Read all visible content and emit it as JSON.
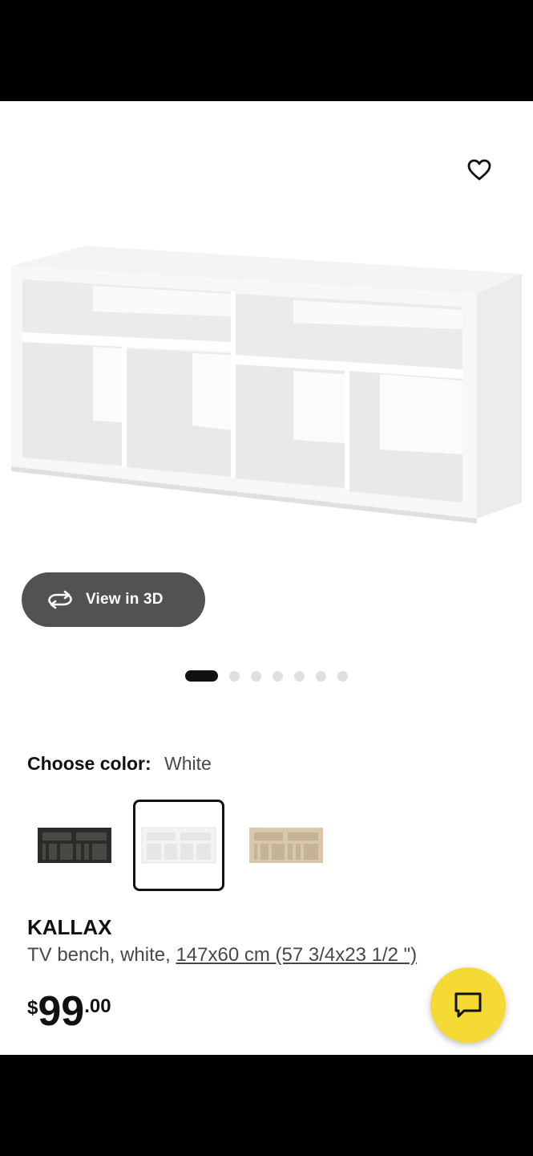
{
  "colors": {
    "accent_chat": "#f5d934",
    "view3d_bg": "#525252",
    "text_primary": "#111111",
    "text_secondary": "#484848"
  },
  "gallery": {
    "favorite_icon": "heart-outline-icon",
    "view3d_label": "View in 3D",
    "view3d_icon": "rotate-3d-icon",
    "total_images": 7,
    "active_index": 0
  },
  "color_choice": {
    "label": "Choose color:",
    "selected": "White",
    "swatches": [
      {
        "name": "black-brown",
        "selected": false
      },
      {
        "name": "white",
        "selected": true
      },
      {
        "name": "white-stained-oak",
        "selected": false
      }
    ]
  },
  "product": {
    "name": "KALLAX",
    "description": "TV bench, white, ",
    "measurement": "147x60 cm (57 3/4x23 1/2 \")"
  },
  "price": {
    "currency": "$",
    "integer": "99",
    "decimal": ".00"
  },
  "chat": {
    "icon": "chat-bubble-icon"
  }
}
